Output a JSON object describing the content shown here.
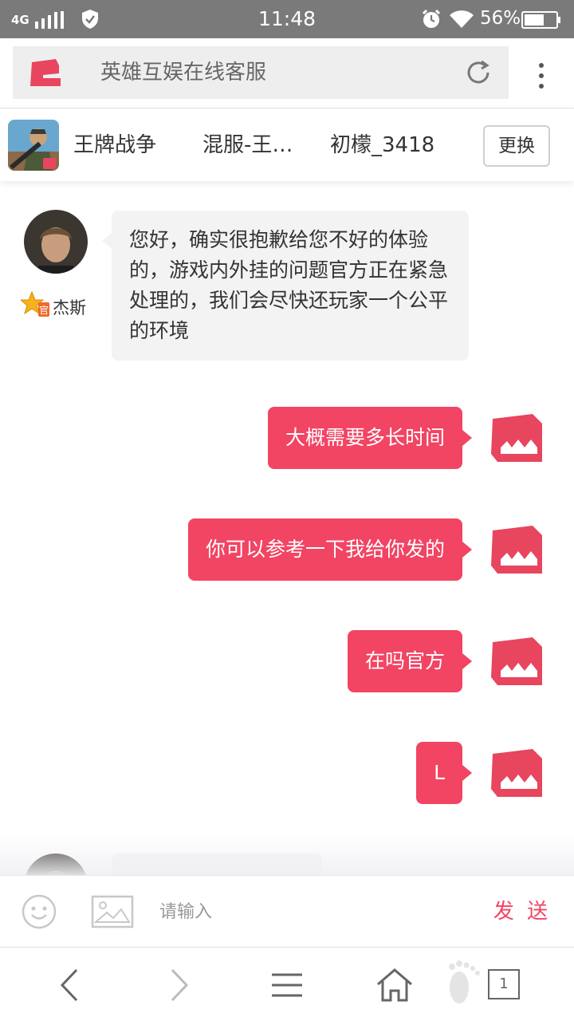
{
  "status_bar": {
    "network": "4G",
    "time": "11:48",
    "battery": "56%",
    "icons": [
      "signal-icon",
      "shield-icon",
      "alarm-icon",
      "wifi-icon",
      "battery-icon"
    ]
  },
  "browser": {
    "title": "英雄互娱在线客服",
    "icons": [
      "site-logo",
      "reload-icon",
      "more-menu-icon"
    ]
  },
  "game_header": {
    "game_name": "王牌战争",
    "server": "混服-王…",
    "player": "初檬_3418",
    "switch_label": "更换"
  },
  "chat": {
    "agent_name": "杰斯",
    "messages": [
      {
        "from": "agent",
        "text": "您好，确实很抱歉给您不好的体验的，游戏内外挂的问题官方正在紧急处理的，我们会尽快还玩家一个公平的环境"
      },
      {
        "from": "user",
        "text": "大概需要多长时间"
      },
      {
        "from": "user",
        "text": "你可以参考一下我给你发的"
      },
      {
        "from": "user",
        "text": "在吗官方"
      },
      {
        "from": "user",
        "text": "L"
      }
    ]
  },
  "input_bar": {
    "placeholder": "请输入",
    "send_label": "发 送",
    "icons": [
      "emoji-icon",
      "image-icon"
    ]
  },
  "bottom_nav": {
    "tab_count": "1",
    "icons": [
      "back-icon",
      "forward-icon",
      "menu-icon",
      "home-icon",
      "footprint-icon",
      "tabs-icon"
    ]
  },
  "colors": {
    "accent": "#f24463",
    "status_bar": "#7a7a7a",
    "incoming_bubble": "#f3f3f3"
  }
}
